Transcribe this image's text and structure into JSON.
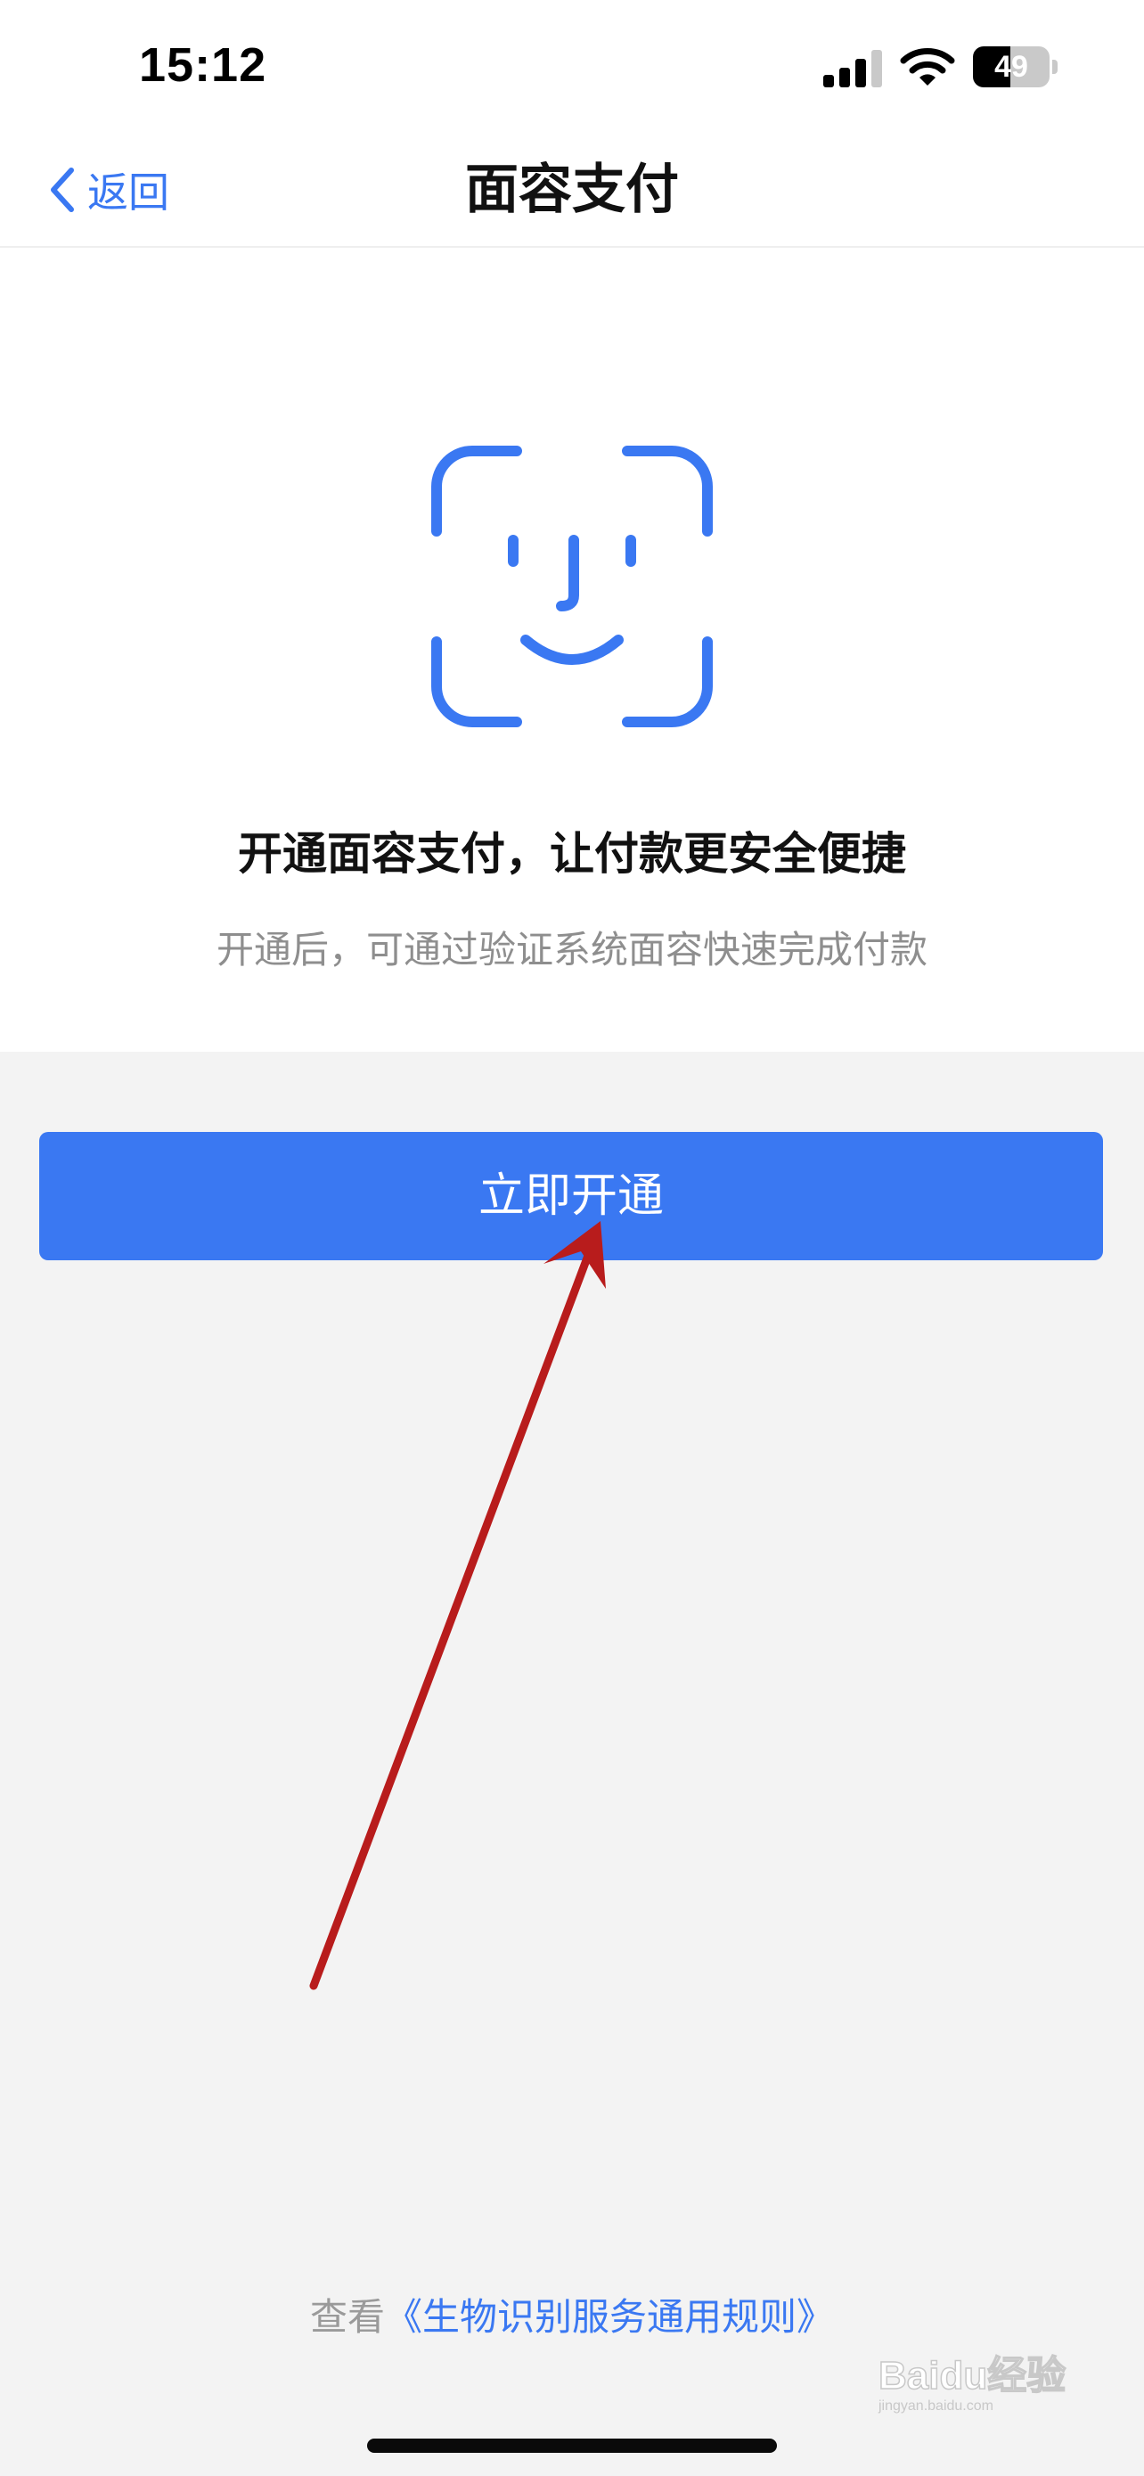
{
  "status_bar": {
    "time": "15:12",
    "battery_level": "49",
    "icons": [
      "signal-icon",
      "wifi-icon",
      "battery-icon"
    ]
  },
  "nav": {
    "back_label": "返回",
    "back_icon": "chevron-left-icon",
    "title": "面容支付"
  },
  "hero": {
    "icon": "face-id-icon",
    "heading": "开通面容支付，让付款更安全便捷",
    "subtext": "开通后，可通过验证系统面容快速完成付款"
  },
  "actions": {
    "activate_label": "立即开通"
  },
  "footer": {
    "prefix": "查看",
    "rules_link": "《生物识别服务通用规则》"
  },
  "watermark": {
    "text": "Baidu经验",
    "subtext": "jingyan.baidu.com"
  },
  "colors": {
    "accent": "#3a78f2",
    "page_bg": "#f3f3f3",
    "card_bg": "#ffffff",
    "annotation": "#b81c1c"
  }
}
